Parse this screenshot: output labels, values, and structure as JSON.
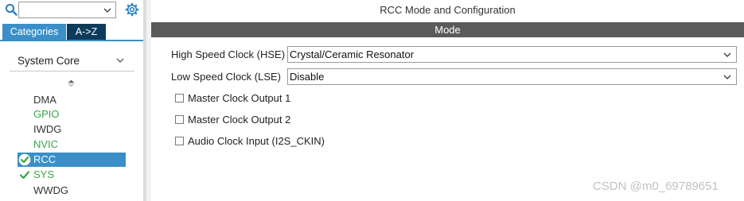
{
  "left_panel": {
    "search": {
      "value": ""
    },
    "tabs": [
      {
        "label": "Categories",
        "active": true
      },
      {
        "label": "A->Z",
        "active": false
      }
    ],
    "section": {
      "label": "System Core"
    },
    "items": [
      {
        "label": "DMA",
        "color": "#333333",
        "status": "none"
      },
      {
        "label": "GPIO",
        "color": "#3aa54a",
        "status": "none"
      },
      {
        "label": "IWDG",
        "color": "#333333",
        "status": "none"
      },
      {
        "label": "NVIC",
        "color": "#3aa54a",
        "status": "none"
      },
      {
        "label": "RCC",
        "color": "#ffffff",
        "status": "configured-selected"
      },
      {
        "label": "SYS",
        "color": "#3aa54a",
        "status": "configured"
      },
      {
        "label": "WWDG",
        "color": "#333333",
        "status": "none"
      }
    ]
  },
  "main": {
    "title": "RCC Mode and Configuration",
    "mode_header": "Mode",
    "fields": [
      {
        "label": "High Speed Clock (HSE)",
        "value": "Crystal/Ceramic Resonator"
      },
      {
        "label": "Low Speed Clock (LSE)",
        "value": "Disable"
      }
    ],
    "checkboxes": [
      {
        "label": "Master Clock Output 1",
        "checked": false
      },
      {
        "label": "Master Clock Output 2",
        "checked": false
      },
      {
        "label": "Audio Clock Input (I2S_CKIN)",
        "checked": false
      }
    ]
  },
  "watermark": "CSDN @m0_69789651",
  "colors": {
    "accent_blue": "#3a8fc8",
    "tab_dark": "#0d3b5c",
    "mode_bar": "#5a5a5a",
    "configured_green": "#3aa54a"
  }
}
